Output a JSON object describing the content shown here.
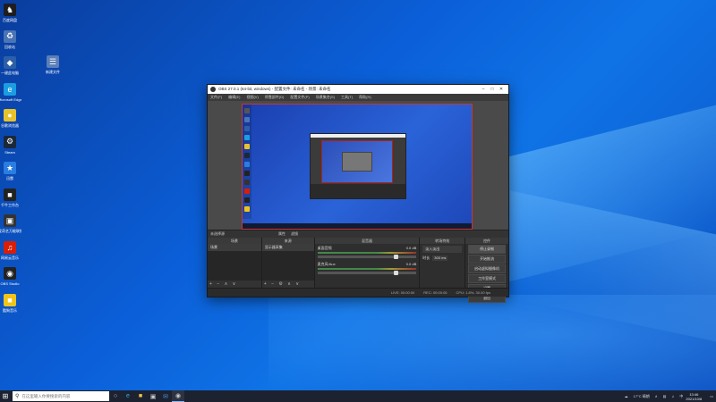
{
  "desktop": {
    "icons": [
      {
        "label": "百度网盘",
        "color": "#1e1e1e",
        "glyph": "♞"
      },
      {
        "label": "回收站",
        "color": "#4a74b5",
        "glyph": "♻"
      },
      {
        "label": "一键此电脑",
        "color": "#2d5fa8",
        "glyph": "◆"
      },
      {
        "label": "Microsoft Edge",
        "color": "#1b9de2",
        "glyph": "e"
      },
      {
        "label": "谷歌浏览器",
        "color": "#e8c22a",
        "glyph": "●"
      },
      {
        "label": "Steam",
        "color": "#1b2838",
        "glyph": "⚙"
      },
      {
        "label": "迅雷",
        "color": "#2a7de1",
        "glyph": "★"
      },
      {
        "label": "千牛工作台",
        "color": "#222",
        "glyph": "■"
      },
      {
        "label": "爱奇艺万能联播",
        "color": "#333",
        "glyph": "▣"
      },
      {
        "label": "网易云音乐",
        "color": "#d81e06",
        "glyph": "♫"
      },
      {
        "label": "OBS Studio",
        "color": "#222",
        "glyph": "◉"
      },
      {
        "label": "酷狗音乐",
        "color": "#f0c419",
        "glyph": "■"
      }
    ],
    "second_icon": {
      "label": "新建文件",
      "glyph": "☰"
    }
  },
  "obs": {
    "title": "OBS 27.0.1 (64-bit, windows) - 配置文件: 未命名 - 场景: 未命名",
    "menu": [
      "文件(F)",
      "编辑(E)",
      "视图(V)",
      "停靠部件(D)",
      "配置文件(P)",
      "场景集合(S)",
      "工具(T)",
      "帮助(H)"
    ],
    "scene_bar": {
      "label": "未选择源",
      "prop": "属性",
      "filter": "滤镜"
    },
    "docks": {
      "scenes": {
        "title": "场景",
        "items": [
          "场景"
        ],
        "controls": "+ − ∧ ∨"
      },
      "sources": {
        "title": "来源",
        "items": [
          "显示器采集"
        ],
        "controls": "+ − ⚙ ∧ ∨"
      },
      "mixer": {
        "title": "混音器",
        "channels": [
          {
            "name": "桌面音频",
            "db": "0.0 dB"
          },
          {
            "name": "麦克风/Aux",
            "db": "0.0 dB"
          }
        ]
      },
      "transitions": {
        "title": "转场特效",
        "type": "淡入淡出",
        "duration_label": "时长",
        "duration": "300 ms"
      },
      "controls": {
        "title": "控件",
        "buttons": [
          "停止录制",
          "开始推流",
          "启动虚拟摄像机",
          "工作室模式",
          "设置",
          "退出"
        ]
      }
    },
    "status": {
      "live": "LIVE: 00:00:00",
      "rec": "REC: 00:00:05",
      "cpu": "CPU: 1.8%, 30.00 fps"
    }
  },
  "taskbar": {
    "search_placeholder": "在这里输入你要搜索的内容",
    "tray": {
      "weather": "17°C 晴朗",
      "lang": "中",
      "time": "13:46",
      "date": "2021/10/8"
    }
  }
}
